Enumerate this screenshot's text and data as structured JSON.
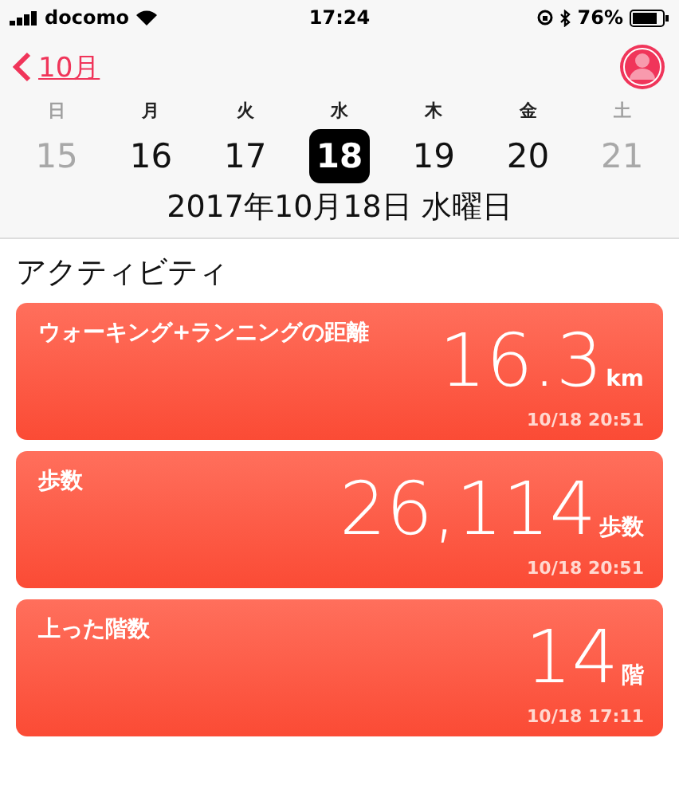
{
  "status_bar": {
    "carrier": "docomo",
    "time": "17:24",
    "battery": "76%"
  },
  "nav": {
    "back_label": "10月"
  },
  "week": [
    {
      "weekday": "日",
      "date": "15",
      "weekend": true,
      "selected": false
    },
    {
      "weekday": "月",
      "date": "16",
      "weekend": false,
      "selected": false
    },
    {
      "weekday": "火",
      "date": "17",
      "weekend": false,
      "selected": false
    },
    {
      "weekday": "水",
      "date": "18",
      "weekend": false,
      "selected": true
    },
    {
      "weekday": "木",
      "date": "19",
      "weekend": false,
      "selected": false
    },
    {
      "weekday": "金",
      "date": "20",
      "weekend": false,
      "selected": false
    },
    {
      "weekday": "土",
      "date": "21",
      "weekend": true,
      "selected": false
    }
  ],
  "selected_date": "2017年10月18日 水曜日",
  "section_title": "アクティビティ",
  "cards": [
    {
      "label": "ウォーキング+ランニングの距離",
      "value": "16.3",
      "unit": "km",
      "timestamp": "10/18 20:51"
    },
    {
      "label": "歩数",
      "value": "26,114",
      "unit": "歩数",
      "timestamp": "10/18 20:51"
    },
    {
      "label": "上った階数",
      "value": "14",
      "unit": "階",
      "timestamp": "10/18 17:11"
    }
  ]
}
